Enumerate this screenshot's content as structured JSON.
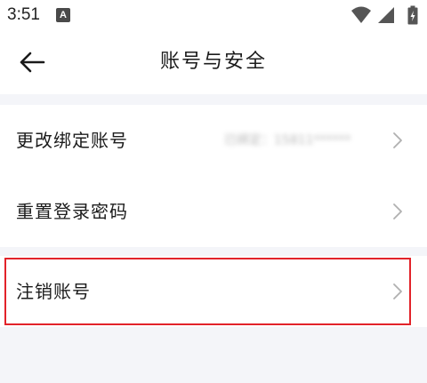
{
  "status_bar": {
    "time": "3:51",
    "notification_icon": "A",
    "icons": [
      "wifi-icon",
      "cell-signal-icon",
      "battery-icon"
    ]
  },
  "header": {
    "title": "账号与安全",
    "back_icon": "arrow-left-icon"
  },
  "settings": {
    "rows": [
      {
        "label": "更改绑定账号",
        "value": "已绑定：15811******",
        "chevron": "chevron-right-icon"
      },
      {
        "label": "重置登录密码",
        "chevron": "chevron-right-icon"
      },
      {
        "label": "注销账号",
        "chevron": "chevron-right-icon",
        "highlighted": true
      }
    ]
  },
  "colors": {
    "background": "#f4f5f9",
    "surface": "#ffffff",
    "text": "#1c1c1c",
    "secondary_text": "#9a9a9a",
    "chevron": "#b0b0b0",
    "highlight": "#e2232a"
  }
}
